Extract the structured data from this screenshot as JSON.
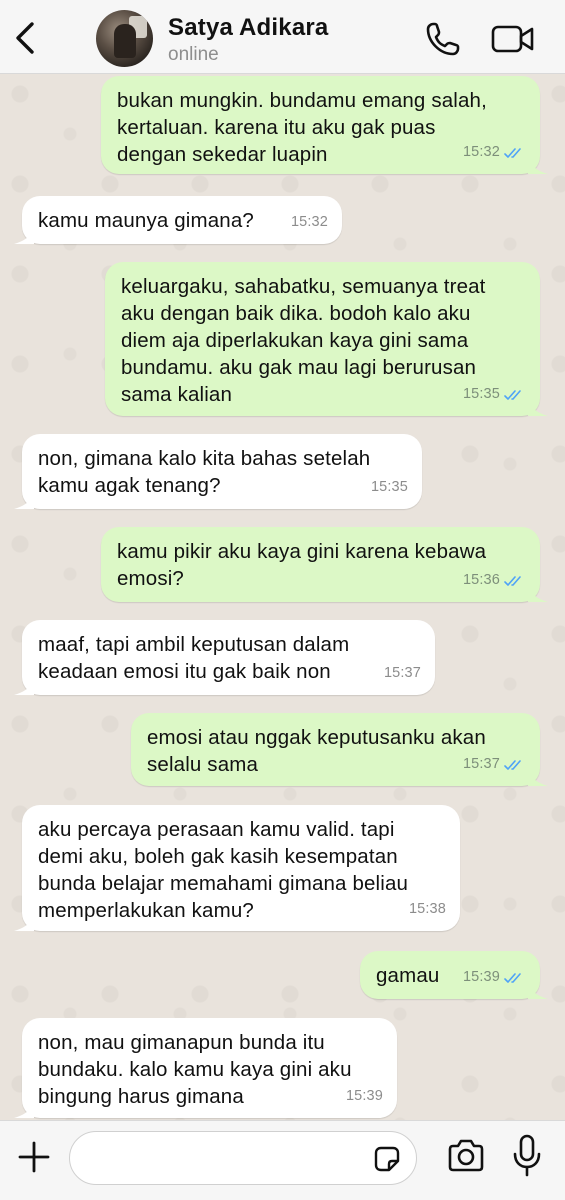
{
  "header": {
    "contact_name": "Satya Adikara",
    "status": "online",
    "back_icon": "chevron-left-icon",
    "call_icon": "phone-icon",
    "video_icon": "video-camera-icon",
    "accent_color": "#007aff"
  },
  "messages": [
    {
      "dir": "out",
      "text": "bukan mungkin. bundamu emang salah,\nkertaluan. karena itu aku gak puas\ndengan sekedar luapin",
      "time": "15:32",
      "read": true
    },
    {
      "dir": "in",
      "text": "kamu maunya gimana?",
      "time": "15:32"
    },
    {
      "dir": "out",
      "text": "keluargaku, sahabatku, semuanya treat\naku dengan baik dika. bodoh kalo aku\ndiem aja diperlakukan kaya gini sama\nbundamu. aku gak mau lagi berurusan\nsama kalian",
      "time": "15:35",
      "read": true
    },
    {
      "dir": "in",
      "text": "non, gimana kalo kita bahas setelah\nkamu agak tenang?",
      "time": "15:35"
    },
    {
      "dir": "out",
      "text": "kamu pikir aku kaya gini karena kebawa\nemosi?",
      "time": "15:36",
      "read": true
    },
    {
      "dir": "in",
      "text": "maaf, tapi ambil keputusan dalam\nkeadaan emosi itu gak baik non",
      "time": "15:37"
    },
    {
      "dir": "out",
      "text": "emosi atau nggak keputusanku akan\nselalu sama",
      "time": "15:37",
      "read": true
    },
    {
      "dir": "in",
      "text": "aku percaya perasaan kamu valid. tapi\ndemi aku, boleh gak kasih kesempatan\nbunda belajar memahami gimana beliau\nmemperlakukan kamu?",
      "time": "15:38"
    },
    {
      "dir": "out",
      "text": "gamau",
      "time": "15:39",
      "read": true
    },
    {
      "dir": "in",
      "text": "non, mau gimanapun bunda itu\nbundaku. kalo kamu kaya gini aku\nbingung harus gimana",
      "time": "15:39"
    }
  ],
  "composer": {
    "placeholder": "",
    "plus_icon": "plus-icon",
    "sticker_icon": "sticker-icon",
    "camera_icon": "camera-icon",
    "mic_icon": "microphone-icon"
  },
  "colors": {
    "outgoing_bubble": "#dcf8c6",
    "incoming_bubble": "#ffffff",
    "read_ticks": "#4fa3f7"
  }
}
